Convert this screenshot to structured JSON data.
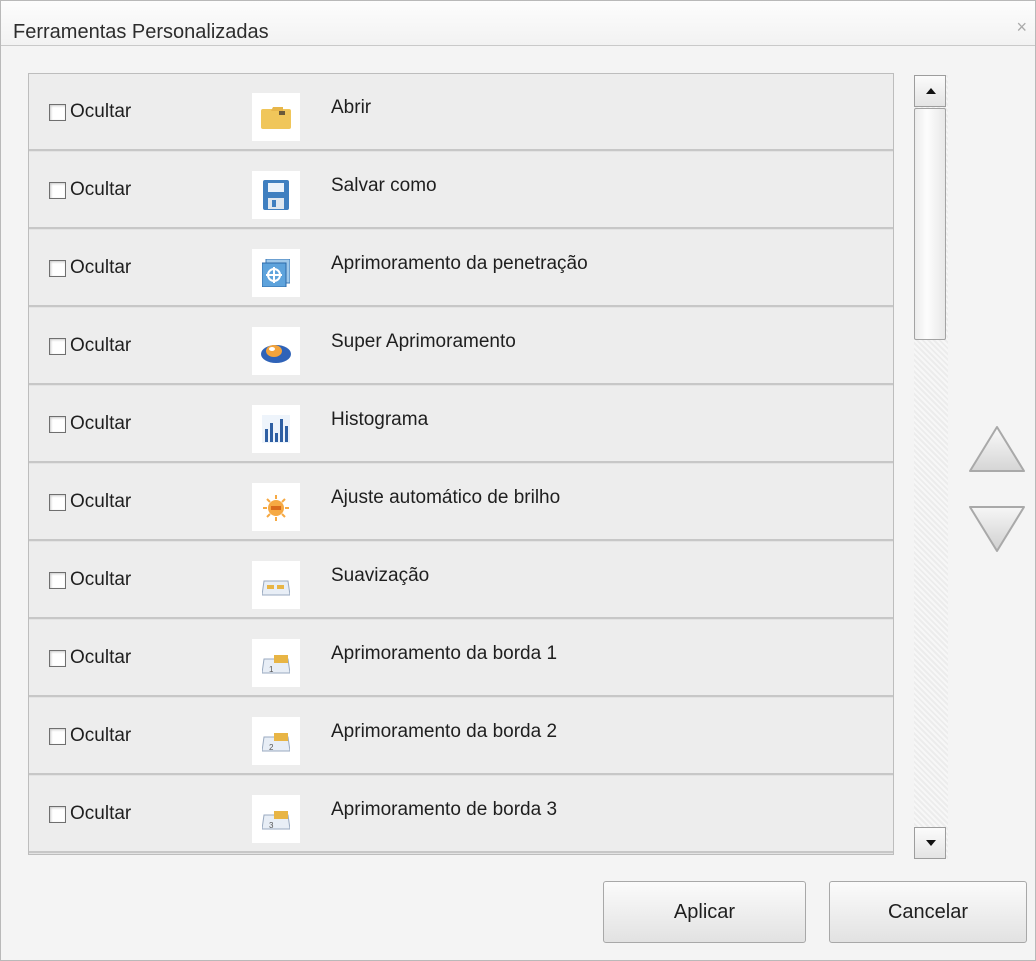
{
  "window": {
    "title": "Ferramentas Personalizadas",
    "close_glyph": "×"
  },
  "items": [
    {
      "hide_label": "Ocultar",
      "hidden": false,
      "icon": "folder-open-icon",
      "name": "Abrir"
    },
    {
      "hide_label": "Ocultar",
      "hidden": false,
      "icon": "floppy-save-as-icon",
      "name": "Salvar como"
    },
    {
      "hide_label": "Ocultar",
      "hidden": false,
      "icon": "penetration-enhance-icon",
      "name": "Aprimoramento da penetração"
    },
    {
      "hide_label": "Ocultar",
      "hidden": false,
      "icon": "super-enhance-icon",
      "name": "Super Aprimoramento"
    },
    {
      "hide_label": "Ocultar",
      "hidden": false,
      "icon": "histogram-icon",
      "name": "Histograma"
    },
    {
      "hide_label": "Ocultar",
      "hidden": false,
      "icon": "auto-brightness-icon",
      "name": "Ajuste automático de brilho"
    },
    {
      "hide_label": "Ocultar",
      "hidden": false,
      "icon": "smoothing-icon",
      "name": "Suavização"
    },
    {
      "hide_label": "Ocultar",
      "hidden": false,
      "icon": "edge-enhance-1-icon",
      "name": "Aprimoramento da borda 1"
    },
    {
      "hide_label": "Ocultar",
      "hidden": false,
      "icon": "edge-enhance-2-icon",
      "name": "Aprimoramento da borda 2"
    },
    {
      "hide_label": "Ocultar",
      "hidden": false,
      "icon": "edge-enhance-3-icon",
      "name": "Aprimoramento de borda 3"
    }
  ],
  "buttons": {
    "apply": "Aplicar",
    "cancel": "Cancelar"
  },
  "colors": {
    "row_bg": "#ededed",
    "list_bg": "#e3e3e3"
  }
}
